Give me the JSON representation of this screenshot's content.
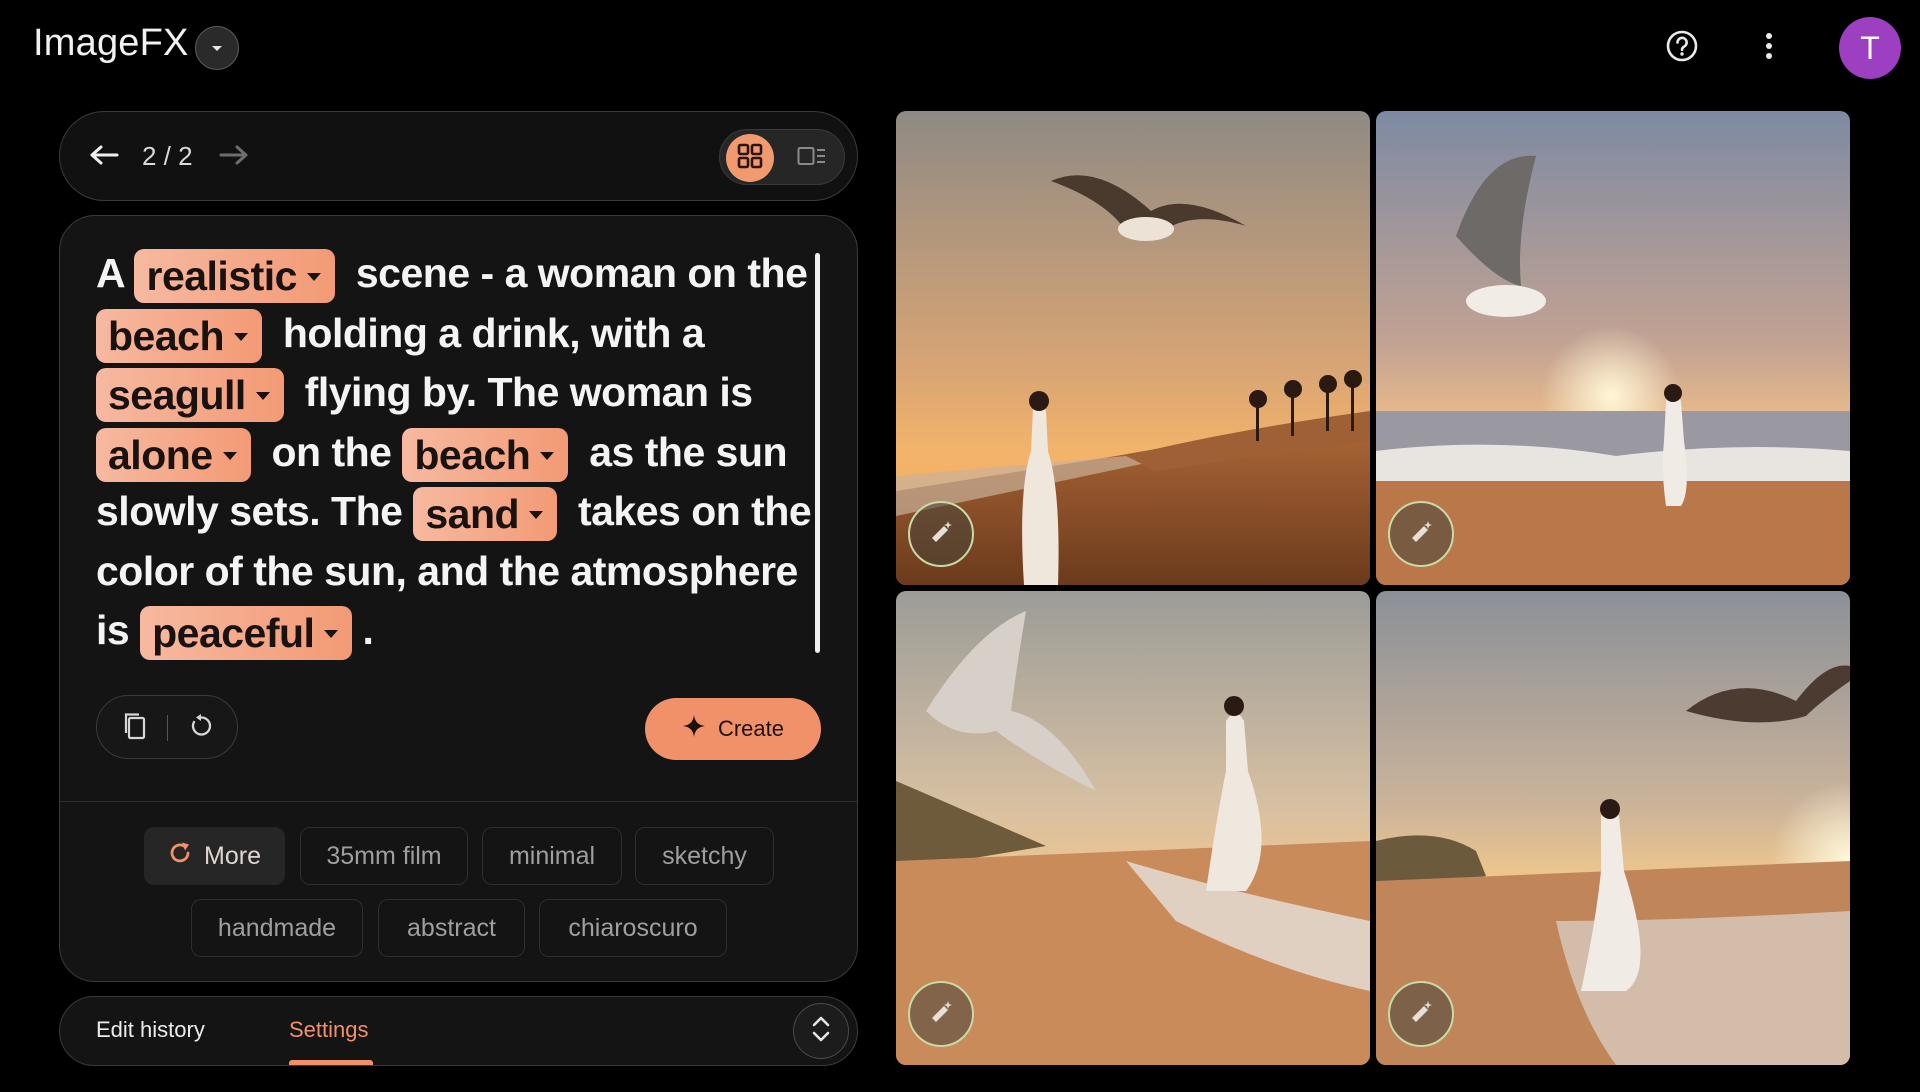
{
  "header": {
    "app_title": "ImageFX",
    "avatar_letter": "T",
    "avatar_color": "#9c3fc0"
  },
  "navigator": {
    "counter": "2 / 2",
    "view_modes": [
      "grid-icon",
      "single-view-icon"
    ],
    "active_view": "grid"
  },
  "prompt": {
    "segments": [
      {
        "type": "text",
        "value": "A "
      },
      {
        "type": "chip",
        "value": "realistic"
      },
      {
        "type": "text",
        "value": " scene - a woman on the "
      },
      {
        "type": "chip",
        "value": "beach"
      },
      {
        "type": "text",
        "value": " holding a drink, with a "
      },
      {
        "type": "chip",
        "value": "seagull"
      },
      {
        "type": "text",
        "value": " flying by. The woman is "
      },
      {
        "type": "chip",
        "value": "alone"
      },
      {
        "type": "text",
        "value": " on the "
      },
      {
        "type": "chip",
        "value": "beach"
      },
      {
        "type": "text",
        "value": " as the sun slowly sets. The "
      },
      {
        "type": "chip",
        "value": "sand"
      },
      {
        "type": "text",
        "value": " takes on the color of the sun, and the atmosphere is "
      },
      {
        "type": "chip",
        "value": "peaceful"
      },
      {
        "type": "text",
        "value": "."
      }
    ]
  },
  "actions": {
    "create_label": "Create"
  },
  "style_tags": {
    "more_label": "More",
    "items": [
      "35mm film",
      "minimal",
      "sketchy",
      "handmade",
      "abstract",
      "chiaroscuro"
    ]
  },
  "bottom_tabs": {
    "edit_history": "Edit history",
    "settings": "Settings",
    "active": "Settings"
  },
  "colors": {
    "accent": "#f0916a",
    "chip_gradient_start": "#f6b9a0",
    "chip_gradient_end": "#f39a75",
    "background": "#000000",
    "card": "#141414"
  },
  "images": [
    {
      "id": "image-1"
    },
    {
      "id": "image-2"
    },
    {
      "id": "image-3"
    },
    {
      "id": "image-4"
    }
  ]
}
